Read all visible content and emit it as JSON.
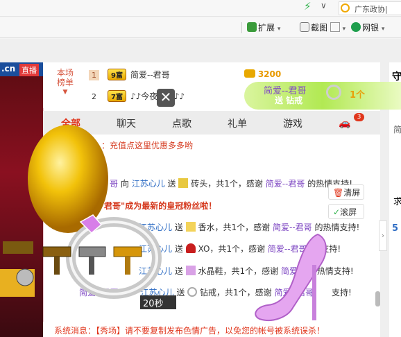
{
  "browser": {
    "address_text": "广东政协|",
    "toolbar": {
      "extensions_label": "扩展",
      "screenshot_label": "截图",
      "netbank_label": "网银"
    }
  },
  "site": {
    "domain_suffix": ".cn",
    "live_label": "直播"
  },
  "ranking": {
    "label": "本场\n榜单",
    "label_line1": "本场",
    "label_line2": "榜单",
    "rows": [
      {
        "rank": "1",
        "vip": "9富",
        "name": "简爱--君哥",
        "score": "3200"
      },
      {
        "rank": "2",
        "vip": "7富",
        "name": "♪♪今夜...眠♪♪",
        "score": ""
      }
    ]
  },
  "gift_popup": {
    "sender": "简爱--君哥",
    "action": "送 钻戒",
    "count": "1个",
    "countdown": "20秒"
  },
  "tabs": [
    {
      "label": "全部"
    },
    {
      "label": "聊天"
    },
    {
      "label": "点歌"
    },
    {
      "label": "礼单"
    },
    {
      "label": "游戏"
    }
  ],
  "tab_badge": "3",
  "chat": {
    "recharge_notice": "：充值点这里优惠多多哟",
    "messages": [
      {
        "prefix": "哥",
        "verb": "向",
        "target": "江苏心儿",
        "send": "送",
        "gift": "砖头",
        "tail": "，共1个，感谢",
        "thanker": "简爱--君哥",
        "end": "的热情支持!"
      },
      {
        "prefix": "君哥\"成为最新的皇冠粉丝啦！"
      },
      {
        "prefix": "",
        "verb": "",
        "target": "江苏心儿",
        "send": "送",
        "gift": "香水",
        "tail": "，共1个，感谢",
        "thanker": "简爱--君哥",
        "end": "的热情支持!"
      },
      {
        "prefix": "",
        "verb": "",
        "target": "江苏心儿",
        "send": "送",
        "gift": "XO",
        "tail": "，共1个，感谢",
        "thanker": "简爱--君哥",
        "end": "支持!"
      },
      {
        "prefix": "",
        "verb": "",
        "target": "江苏心儿",
        "send": "送",
        "gift": "水晶鞋",
        "tail": "，共1个，感谢",
        "thanker": "简爱",
        "end": "热情支持!"
      },
      {
        "prefix": "简爱--君哥",
        "verb": "",
        "target": "江苏心儿",
        "send": "送",
        "gift": "钻戒",
        "tail": "，共1个，感谢",
        "thanker": "简爱--君哥",
        "end": "支持!"
      }
    ],
    "clear_label": "清屏",
    "scroll_label": "滚屏"
  },
  "system_message": "系统消息：【秀场】请不要复制发布色情广告，以免您的帐号被系统误杀！",
  "right_col": {
    "top_char": "守",
    "c1": "简",
    "c2": "求",
    "c3": "5"
  },
  "colors": {
    "accent": "#e0361c",
    "link": "#2d6cc4",
    "gold": "#e89a00"
  }
}
